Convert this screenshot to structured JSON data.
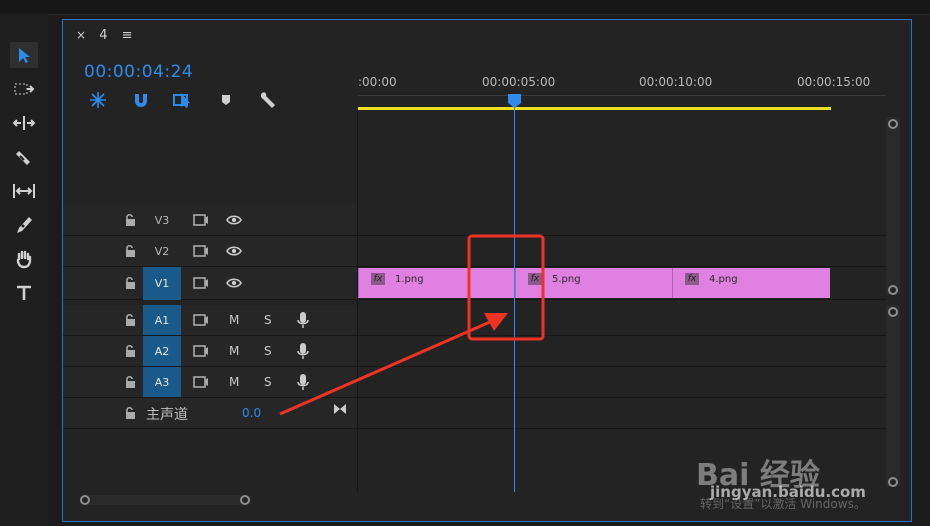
{
  "panel": {
    "close_glyph": "×",
    "sequence_label": "4",
    "menu_glyph": "≡"
  },
  "timecode": "00:00:04:24",
  "ruler": {
    "labels": [
      ":00:00",
      "00:00:05:00",
      "00:00:10:00",
      "00:00:15:00"
    ]
  },
  "video_tracks": [
    {
      "name": "V3",
      "selected": false
    },
    {
      "name": "V2",
      "selected": false
    },
    {
      "name": "V1",
      "selected": true
    }
  ],
  "audio_tracks": [
    {
      "name": "A1",
      "mute": "M",
      "solo": "S"
    },
    {
      "name": "A2",
      "mute": "M",
      "solo": "S"
    },
    {
      "name": "A3",
      "mute": "M",
      "solo": "S"
    }
  ],
  "master": {
    "label": "主声道",
    "value": "0.0"
  },
  "clips": [
    {
      "name": "1.png",
      "fx": "fx"
    },
    {
      "name": "5.png",
      "fx": "fx"
    },
    {
      "name": "4.png",
      "fx": "fx"
    }
  ],
  "watermark": {
    "brand": "Bai 经验",
    "url": "jingyan.baidu.com",
    "activate": "转到“设置”以激活 Windows。"
  },
  "colors": {
    "accent": "#2d8ceb",
    "clip": "#e080e0",
    "work_area": "#f0e020",
    "annotation": "#ee3322"
  }
}
